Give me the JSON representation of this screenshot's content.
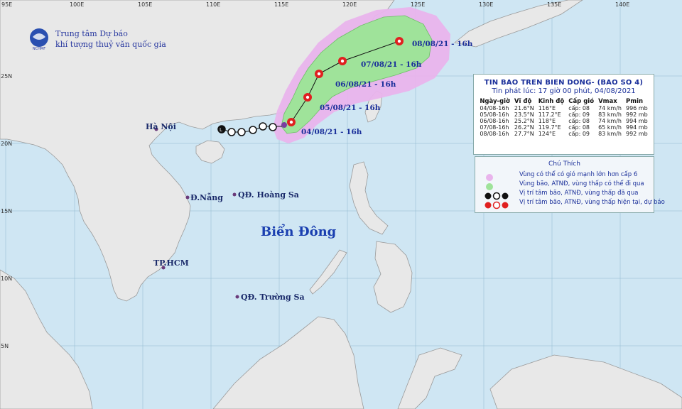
{
  "organization": {
    "line1": "Trung tâm Dự báo",
    "line2": "khí tượng thuỷ văn quốc gia",
    "logo_text": "NCHMF"
  },
  "longitude_ticks": [
    "95E",
    "100E",
    "105E",
    "110E",
    "115E",
    "120E",
    "125E",
    "130E",
    "135E",
    "140E"
  ],
  "latitude_ticks": [
    "25N",
    "20N",
    "15N",
    "10N",
    "5N"
  ],
  "places": {
    "hanoi": "Hà Nội",
    "danang": "Đ.Nẵng",
    "hoangsa": "QĐ. Hoàng Sa",
    "truongsa": "QĐ. Trường Sa",
    "tphcm": "TP.HCM",
    "sea": "Biển Đông"
  },
  "forecast_labels": [
    "04/08/21 - 16h",
    "05/08/21 - 16h",
    "06/08/21 - 16h",
    "07/08/21 - 16h",
    "08/08/21 - 16h"
  ],
  "bulletin": {
    "title": "TIN BAO TREN BIEN DONG- (BAO SO 4)",
    "issued": "Tin phát lúc: 17 giờ 00 phút, 04/08/2021",
    "headers": [
      "Ngày-giờ",
      "Vĩ độ",
      "Kinh độ",
      "Cấp gió",
      "Vmax",
      "Pmin"
    ],
    "rows": [
      [
        "04/08-16h",
        "21.6°N",
        "116°E",
        "cấp: 08",
        "74 km/h",
        "996 mb"
      ],
      [
        "05/08-16h",
        "23.5°N",
        "117.2°E",
        "cấp: 09",
        "83 km/h",
        "992 mb"
      ],
      [
        "06/08-16h",
        "25.2°N",
        "118°E",
        "cấp: 08",
        "74 km/h",
        "994 mb"
      ],
      [
        "07/08-16h",
        "26.2°N",
        "119.7°E",
        "cấp: 08",
        "65 km/h",
        "994 mb"
      ],
      [
        "08/08-16h",
        "27.7°N",
        "124°E",
        "cấp: 09",
        "83 km/h",
        "992 mb"
      ]
    ]
  },
  "legend": {
    "title": "Chú Thích",
    "items": [
      "Vùng có thể có gió mạnh lớn hơn cấp 6",
      "Vùng bão, ATNĐ, vùng thấp có thể đi qua",
      "Vị trí tâm bão, ATNĐ, vùng thấp đã qua",
      "Vị trí tâm bão, ATNĐ, vùng thấp hiện tại, dự báo"
    ]
  },
  "colors": {
    "sea": "#cfe6f3",
    "land": "#e8e8e8",
    "strong_wind_zone": "#e9b4ec",
    "storm_zone": "#9fe39a",
    "track_current": "#e02020",
    "track_past": "#111111"
  }
}
